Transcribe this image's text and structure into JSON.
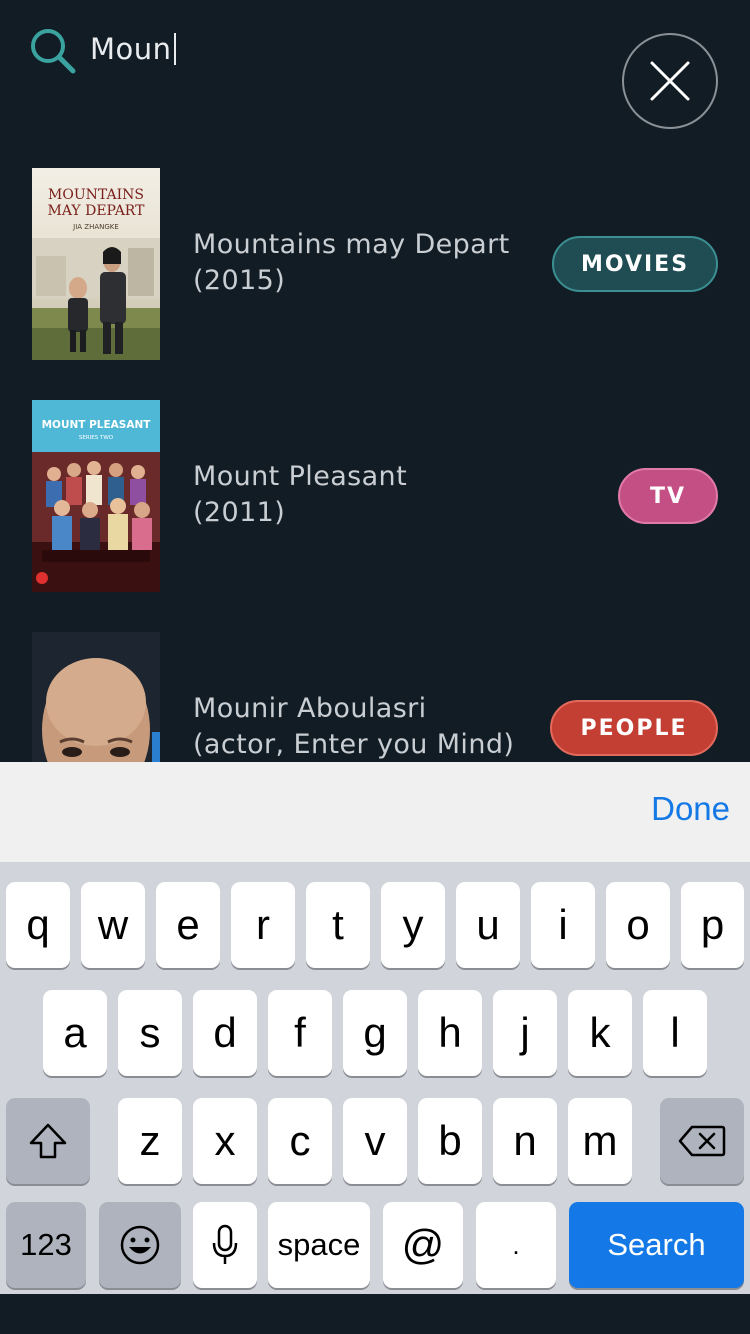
{
  "search": {
    "query": "Moun"
  },
  "results": [
    {
      "title_line1": "Mountains may Depart",
      "title_line2": "(2015)",
      "category": "MOVIES",
      "poster": {
        "title_line1": "MOUNTAINS",
        "title_line2": "MAY DEPART",
        "director": "JIA ZHANGKE"
      }
    },
    {
      "title_line1": "Mount Pleasant",
      "title_line2": "(2011)",
      "category": "TV",
      "poster": {
        "title": "MOUNT PLEASANT",
        "subtitle": "SERIES TWO"
      }
    },
    {
      "title_line1": "Mounir Aboulasri",
      "title_line2": "(actor, Enter you Mind)",
      "category": "PEOPLE"
    }
  ],
  "accessory": {
    "done_label": "Done"
  },
  "keyboard": {
    "row1": [
      "q",
      "w",
      "e",
      "r",
      "t",
      "y",
      "u",
      "i",
      "o",
      "p"
    ],
    "row2": [
      "a",
      "s",
      "d",
      "f",
      "g",
      "h",
      "j",
      "k",
      "l"
    ],
    "row3": [
      "z",
      "x",
      "c",
      "v",
      "b",
      "n",
      "m"
    ],
    "numbers_label": "123",
    "space_label": "space",
    "at_label": "@",
    "dot_label": ".",
    "search_label": "Search"
  },
  "colors": {
    "background": "#121c24",
    "movies": "#1f4d53",
    "tv": "#c44f84",
    "people": "#c33f33",
    "accent_blue": "#1479e6",
    "search_icon": "#3aa39f"
  },
  "icons": {
    "search": "search-icon",
    "close": "close-icon",
    "shift": "shift-icon",
    "backspace": "backspace-icon",
    "emoji": "emoji-icon",
    "mic": "microphone-icon"
  }
}
